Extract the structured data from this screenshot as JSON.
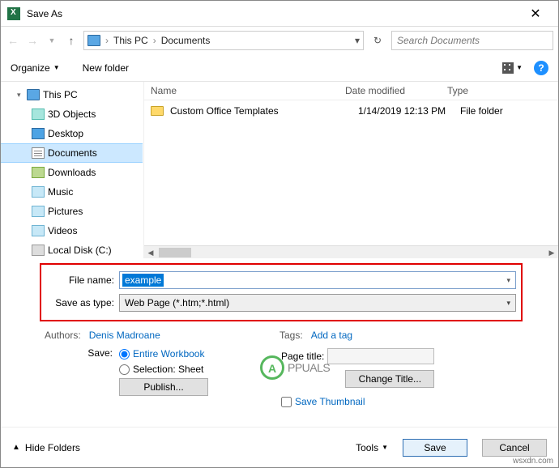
{
  "window": {
    "title": "Save As"
  },
  "breadcrumb": {
    "root_icon": "pc-icon",
    "items": [
      "This PC",
      "Documents"
    ]
  },
  "search": {
    "placeholder": "Search Documents"
  },
  "toolbar": {
    "organize": "Organize",
    "new_folder": "New folder"
  },
  "tree": {
    "root": "This PC",
    "items": [
      {
        "label": "3D Objects",
        "ico": "ico-3d"
      },
      {
        "label": "Desktop",
        "ico": "ico-desktop"
      },
      {
        "label": "Documents",
        "ico": "ico-docs",
        "selected": true
      },
      {
        "label": "Downloads",
        "ico": "ico-down"
      },
      {
        "label": "Music",
        "ico": "ico-music"
      },
      {
        "label": "Pictures",
        "ico": "ico-pics"
      },
      {
        "label": "Videos",
        "ico": "ico-vids"
      },
      {
        "label": "Local Disk (C:)",
        "ico": "ico-disk"
      }
    ]
  },
  "columns": {
    "name": "Name",
    "date": "Date modified",
    "type": "Type"
  },
  "rows": [
    {
      "name": "Custom Office Templates",
      "date": "1/14/2019 12:13 PM",
      "type": "File folder"
    }
  ],
  "filename": {
    "label": "File name:",
    "value": "example"
  },
  "savetype": {
    "label": "Save as type:",
    "value": "Web Page (*.htm;*.html)"
  },
  "authors": {
    "label": "Authors:",
    "value": "Denis Madroane"
  },
  "tags": {
    "label": "Tags:",
    "value": "Add a tag"
  },
  "save_section": {
    "label": "Save:",
    "opt1": "Entire Workbook",
    "opt2": "Selection: Sheet",
    "publish": "Publish..."
  },
  "page_title": {
    "label": "Page title:",
    "change": "Change Title..."
  },
  "save_thumbnail": "Save Thumbnail",
  "footer": {
    "hide_folders": "Hide Folders",
    "tools": "Tools",
    "save": "Save",
    "cancel": "Cancel"
  },
  "watermark": {
    "brand": "PPUALS",
    "source": "wsxdn.com"
  }
}
